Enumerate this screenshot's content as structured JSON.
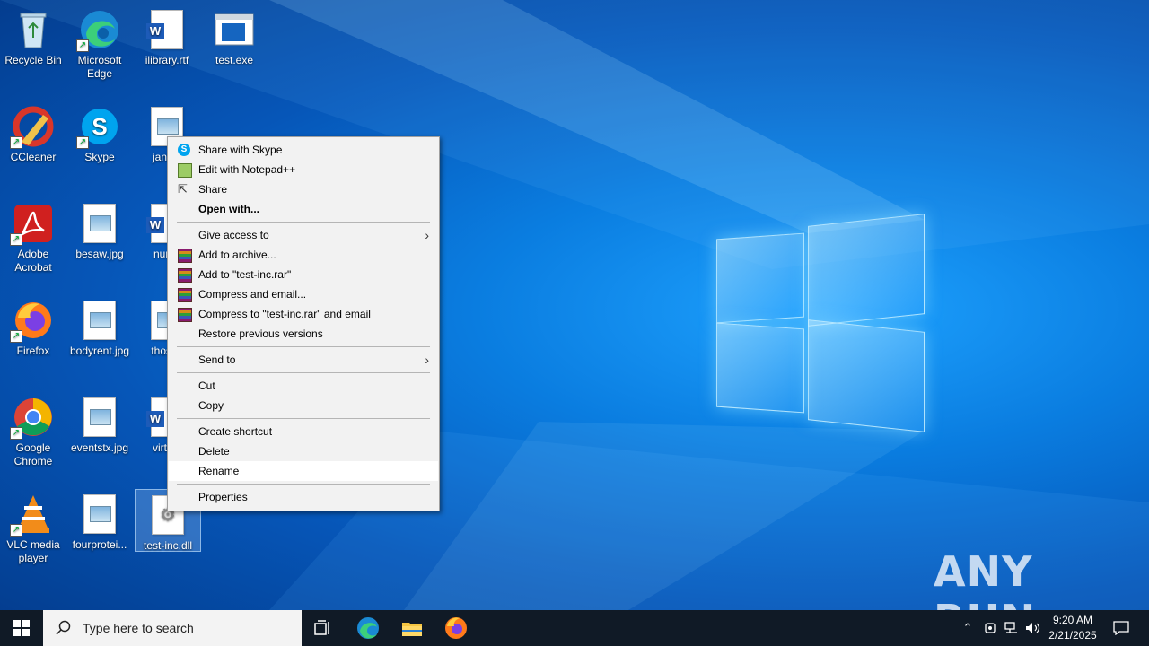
{
  "desktop": {
    "icons": [
      {
        "label": "Recycle Bin"
      },
      {
        "label": "Microsoft Edge"
      },
      {
        "label": "ilibrary.rtf"
      },
      {
        "label": "test.exe"
      },
      {
        "label": "CCleaner"
      },
      {
        "label": "Skype"
      },
      {
        "label": "janbal"
      },
      {
        "label": "Adobe Acrobat"
      },
      {
        "label": "besaw.jpg"
      },
      {
        "label": "numb"
      },
      {
        "label": "Firefox"
      },
      {
        "label": "bodyrent.jpg"
      },
      {
        "label": "thoses"
      },
      {
        "label": "Google Chrome"
      },
      {
        "label": "eventstx.jpg"
      },
      {
        "label": "virtual"
      },
      {
        "label": "VLC media player"
      },
      {
        "label": "fourprotei..."
      },
      {
        "label": "test-inc.dll"
      }
    ]
  },
  "context_menu": {
    "items": [
      {
        "label": "Share with Skype",
        "icon": "skype-icon"
      },
      {
        "label": "Edit with Notepad++",
        "icon": "notepadpp-icon"
      },
      {
        "label": "Share",
        "icon": "share-icon"
      },
      {
        "label": "Open with...",
        "bold": true
      },
      {
        "label": "Give access to",
        "submenu": true
      },
      {
        "label": "Add to archive...",
        "icon": "winrar-icon"
      },
      {
        "label": "Add to \"test-inc.rar\"",
        "icon": "winrar-icon"
      },
      {
        "label": "Compress and email...",
        "icon": "winrar-icon"
      },
      {
        "label": "Compress to \"test-inc.rar\" and email",
        "icon": "winrar-icon"
      },
      {
        "label": "Restore previous versions"
      },
      {
        "label": "Send to",
        "submenu": true
      },
      {
        "label": "Cut"
      },
      {
        "label": "Copy"
      },
      {
        "label": "Create shortcut"
      },
      {
        "label": "Delete"
      },
      {
        "label": "Rename",
        "highlighted": true
      },
      {
        "label": "Properties"
      }
    ],
    "submenu_arrow": "›"
  },
  "taskbar": {
    "search_placeholder": "Type here to search",
    "time": "9:20 AM",
    "date": "2/21/2025"
  },
  "watermark": "ANY RUN",
  "colors": {
    "menu_bg": "#f2f2f2",
    "taskbar_bg": "#101a26",
    "desktop_accent": "#0a7de0"
  }
}
